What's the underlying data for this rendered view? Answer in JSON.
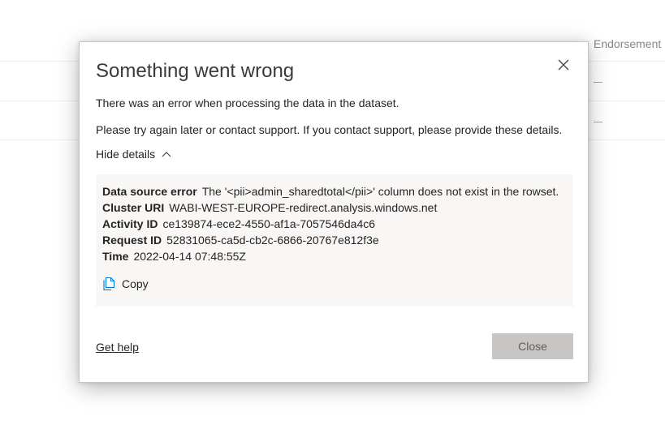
{
  "background": {
    "column_header": "Endorsement",
    "dash_1": "—",
    "dash_2": "—"
  },
  "dialog": {
    "title": "Something went wrong",
    "message_1": "There was an error when processing the data in the dataset.",
    "message_2": "Please try again later or contact support. If you contact support, please provide these details.",
    "toggle_label": "Hide details",
    "details": {
      "data_source_error": {
        "label": "Data source error",
        "value": "The '<pii>admin_sharedtotal</pii>' column does not exist in the rowset."
      },
      "cluster_uri": {
        "label": "Cluster URI",
        "value": "WABI-WEST-EUROPE-redirect.analysis.windows.net"
      },
      "activity_id": {
        "label": "Activity ID",
        "value": "ce139874-ece2-4550-af1a-7057546da4c6"
      },
      "request_id": {
        "label": "Request ID",
        "value": "52831065-ca5d-cb2c-6866-20767e812f3e"
      },
      "time": {
        "label": "Time",
        "value": "2022-04-14 07:48:55Z"
      }
    },
    "copy_label": "Copy",
    "help_link": "Get help",
    "close_button": "Close"
  },
  "colors": {
    "accent": "#0078d4",
    "button_disabled_bg": "#c8c6c4",
    "details_bg": "#f8f7f6"
  },
  "icons": {
    "close": "close-icon",
    "toggle": "chevron-up-icon",
    "copy": "copy-icon"
  }
}
